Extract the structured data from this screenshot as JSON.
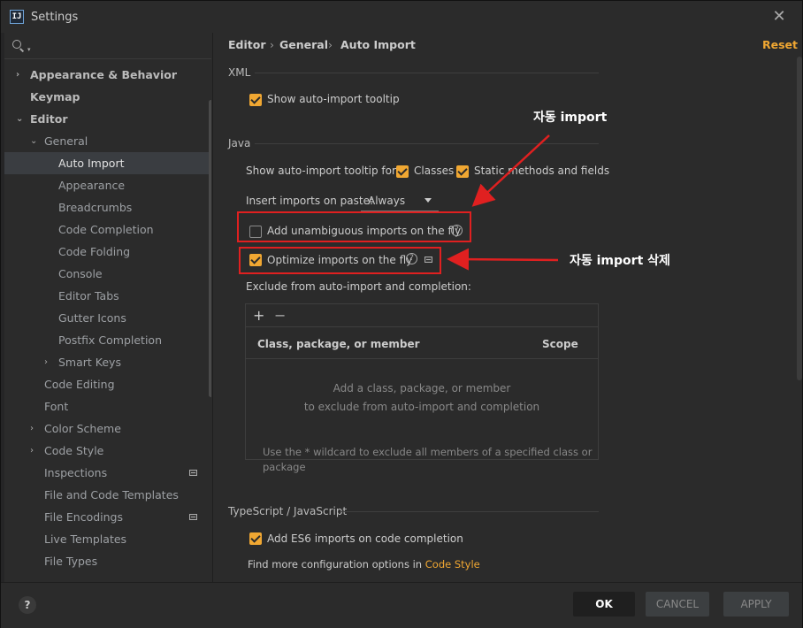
{
  "window": {
    "title": "Settings",
    "app_icon": "IJ"
  },
  "sidebar": {
    "items": [
      {
        "label": "Appearance & Behavior",
        "bold": true,
        "chevron": "›"
      },
      {
        "label": "Keymap",
        "bold": true,
        "chevron": ""
      },
      {
        "label": "Editor",
        "bold": true,
        "chevron": "⌄"
      },
      {
        "label": "General",
        "chevron": "⌄"
      },
      {
        "label": "Auto Import",
        "selected": true
      },
      {
        "label": "Appearance"
      },
      {
        "label": "Breadcrumbs"
      },
      {
        "label": "Code Completion"
      },
      {
        "label": "Code Folding"
      },
      {
        "label": "Console"
      },
      {
        "label": "Editor Tabs"
      },
      {
        "label": "Gutter Icons"
      },
      {
        "label": "Postfix Completion"
      },
      {
        "label": "Smart Keys",
        "chevron": "›"
      },
      {
        "label": "Code Editing"
      },
      {
        "label": "Font"
      },
      {
        "label": "Color Scheme",
        "chevron": "›"
      },
      {
        "label": "Code Style",
        "chevron": "›"
      },
      {
        "label": "Inspections",
        "badge": true
      },
      {
        "label": "File and Code Templates"
      },
      {
        "label": "File Encodings",
        "badge": true
      },
      {
        "label": "Live Templates"
      },
      {
        "label": "File Types"
      }
    ]
  },
  "breadcrumb": {
    "items": [
      "Editor",
      "General",
      "Auto Import"
    ],
    "separator": "›"
  },
  "reset_label": "Reset",
  "xml": {
    "title": "XML",
    "show_tooltip": {
      "label": "Show auto-import tooltip",
      "checked": true
    }
  },
  "java": {
    "title": "Java",
    "tooltip_for_label": "Show auto-import tooltip for:",
    "classes": {
      "label": "Classes",
      "checked": true
    },
    "static_methods": {
      "label": "Static methods and fields",
      "checked": true
    },
    "insert_imports_label": "Insert imports on paste:",
    "insert_imports_value": "Always",
    "add_unambiguous": {
      "label": "Add unambiguous imports on the fly",
      "checked": false
    },
    "optimize_imports": {
      "label": "Optimize imports on the fly",
      "checked": true
    },
    "exclude_label": "Exclude from auto-import and completion:",
    "table": {
      "add": "+",
      "remove": "−",
      "col_member": "Class, package, or member",
      "col_scope": "Scope",
      "empty_line1": "Add a class, package, or member",
      "empty_line2": "to exclude from auto-import and completion"
    },
    "hint": "Use the * wildcard to exclude all members of a specified class or package"
  },
  "typescript": {
    "title": "TypeScript / JavaScript",
    "add_es6": {
      "label": "Add ES6 imports on code completion",
      "checked": true
    },
    "find_more_prefix": "Find more configuration options in ",
    "find_more_link": "Code Style"
  },
  "annotations": {
    "auto_import": "자동 import",
    "auto_import_remove": "자동 import 삭제"
  },
  "footer": {
    "help": "?",
    "ok": "OK",
    "cancel": "CANCEL",
    "apply": "APPLY"
  },
  "colors": {
    "accent": "#f0a732",
    "annotation_red": "#e02020"
  }
}
